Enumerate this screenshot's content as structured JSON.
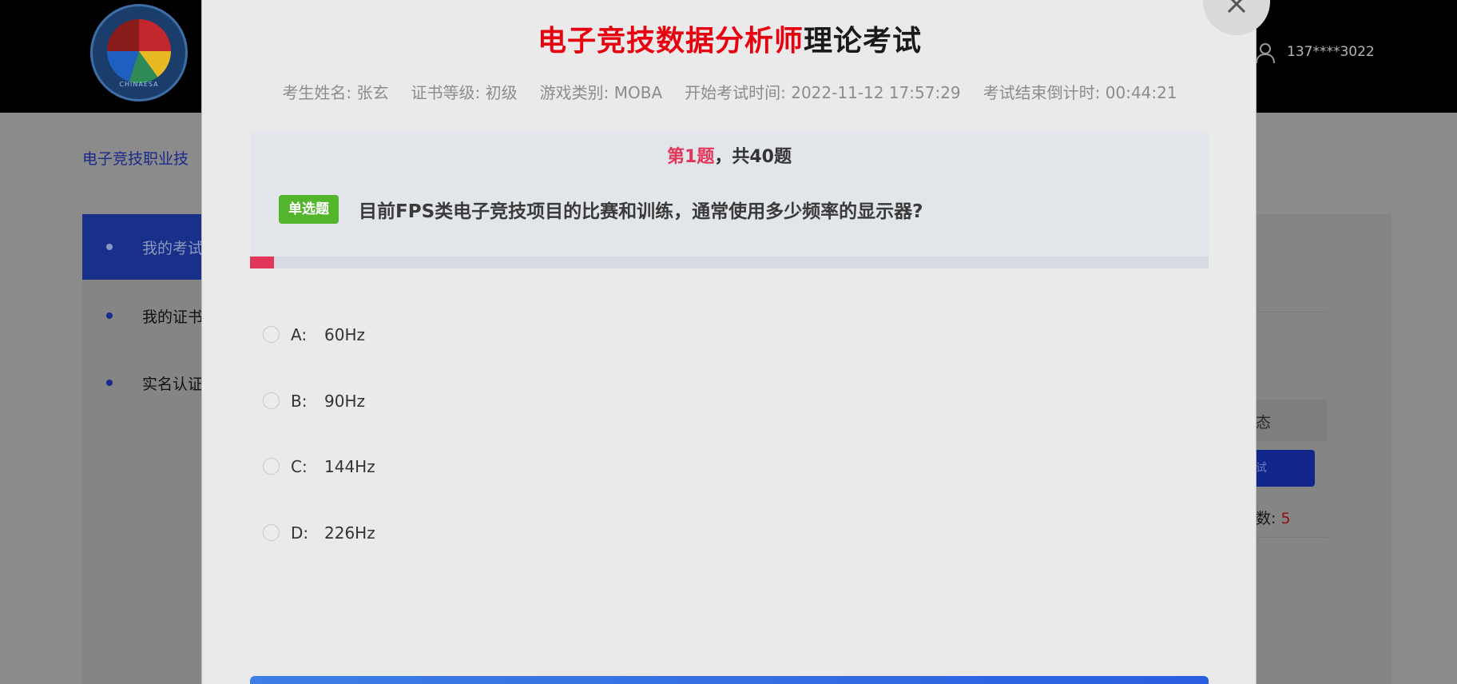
{
  "header": {
    "logo_text": "CHINAESA",
    "user_phone": "137****3022"
  },
  "background": {
    "breadcrumb": "电子竞技职业技",
    "sidebar": {
      "items": [
        {
          "label": "我的考试"
        },
        {
          "label": "我的证书"
        },
        {
          "label": "实名认证"
        }
      ]
    },
    "right_panel": {
      "status_header": "态",
      "button_label": "试",
      "count_label": "数:",
      "count_value": "5"
    }
  },
  "modal": {
    "title_highlight": "电子竞技数据分析师",
    "title_rest": "理论考试",
    "info": {
      "name": "考生姓名: 张玄",
      "level": "证书等级: 初级",
      "game_type": "游戏类别: MOBA",
      "start_time": "开始考试时间: 2022-11-12 17:57:29",
      "countdown": "考试结束倒计时: 00:44:21"
    },
    "question": {
      "counter_current": "第1题",
      "counter_total": "，共40题",
      "type_tag": "单选题",
      "text": "目前FPS类电子竞技项目的比赛和训练，通常使用多少频率的显示器?",
      "progress": 0.025
    },
    "options": [
      {
        "letter": "A:",
        "text": "60Hz"
      },
      {
        "letter": "B:",
        "text": "90Hz"
      },
      {
        "letter": "C:",
        "text": "144Hz"
      },
      {
        "letter": "D:",
        "text": "226Hz"
      }
    ],
    "close_icon": "close-icon"
  },
  "colors": {
    "accent_red": "#e3345a",
    "title_red": "#e8000f",
    "tag_green": "#52b52c",
    "primary_blue": "#2a5fe0"
  }
}
